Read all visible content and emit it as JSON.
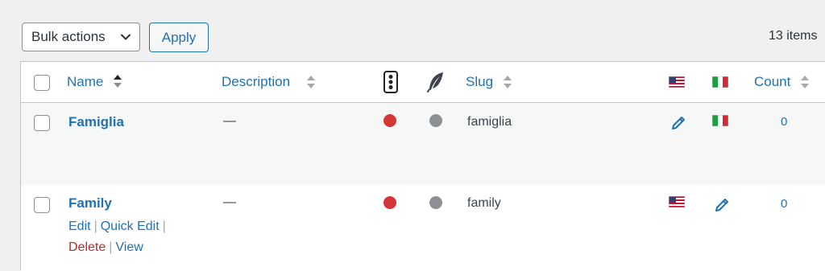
{
  "tablenav": {
    "bulk_actions": "Bulk actions",
    "apply_label": "Apply",
    "items_count": "13 items"
  },
  "columns": {
    "name": "Name",
    "description": "Description",
    "slug": "Slug",
    "count": "Count"
  },
  "icons": {
    "status": "traffic-light-icon",
    "language": "feather-icon",
    "flag_us": "us-flag-icon",
    "flag_it": "it-flag-icon",
    "edit_translation": "pencil-icon"
  },
  "rows": [
    {
      "name": "Famiglia",
      "description": "—",
      "status_color": "#d63638",
      "slug": "famiglia",
      "count": "0"
    },
    {
      "name": "Family",
      "description": "—",
      "status_color": "#d63638",
      "slug": "family",
      "count": "0",
      "actions": {
        "edit": "Edit",
        "quick_edit": "Quick Edit",
        "delete": "Delete",
        "view": "View"
      }
    }
  ],
  "colors": {
    "link": "#2271b1",
    "delete": "#b32d2e",
    "background": "#f0f0f1"
  }
}
